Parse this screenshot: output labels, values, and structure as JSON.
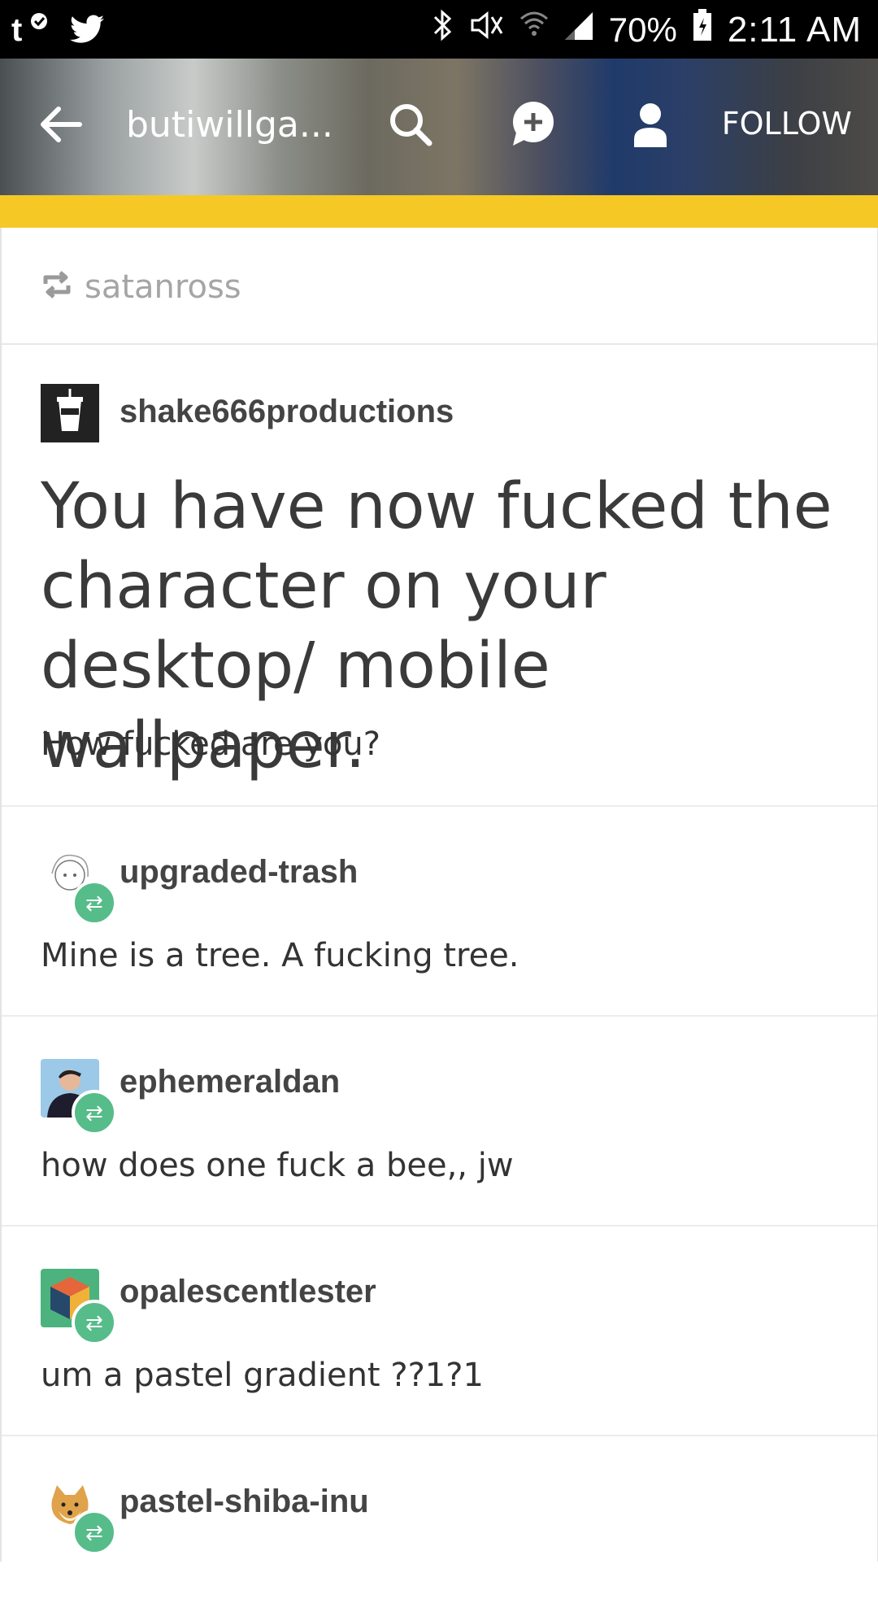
{
  "status_bar": {
    "left_icons": [
      "tumblr-notification-icon",
      "twitter-icon"
    ],
    "right_icons": [
      "bluetooth-icon",
      "mute-icon",
      "wifi-icon",
      "signal-icon"
    ],
    "battery": "70%",
    "time": "2:11 AM"
  },
  "header": {
    "blog_title": "butiwillga...",
    "follow_label": "FOLLOW"
  },
  "reblog": {
    "from": "satanross"
  },
  "op": {
    "username": "shake666productions",
    "headline": "You have now fucked the character on your desktop/ mobile wallpaper.",
    "subtext": "How fucked are you?"
  },
  "replies": [
    {
      "username": "upgraded-trash",
      "body": "Mine is a tree. A fucking tree."
    },
    {
      "username": "ephemeraldan",
      "body": "how does one fuck a bee,, jw"
    },
    {
      "username": "opalescentlester",
      "body": "um a pastel gradient ??1?1"
    },
    {
      "username": "pastel-shiba-inu",
      "body": ""
    }
  ],
  "colors": {
    "accent": "#f5c826",
    "reblog_badge": "#56bc8a"
  }
}
